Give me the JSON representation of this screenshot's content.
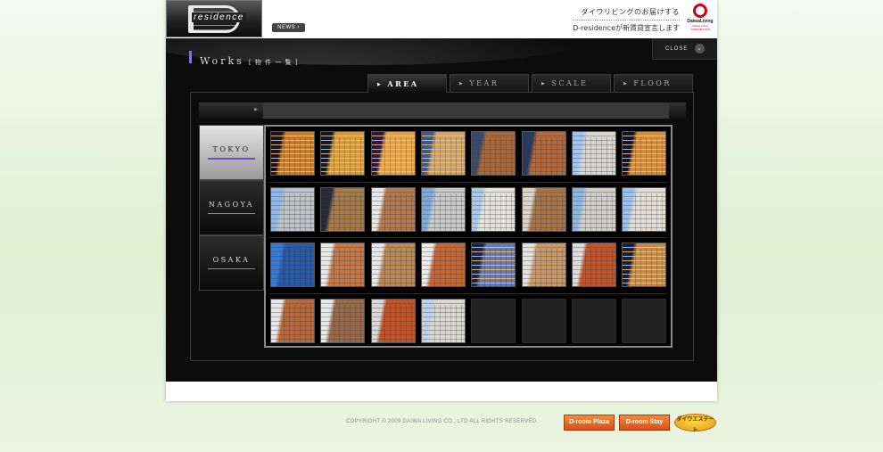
{
  "header": {
    "logo_text": "residence",
    "news_label": "NEWS ›",
    "tagline_line1": "ダイワリビングのお届けする",
    "tagline_line2": "D-residenceが新賃貸宣言します",
    "brand_name": "DaiwaLiving",
    "brand_sub": "Daiwa Living CORPORATION"
  },
  "main": {
    "close_label": "CLOSE",
    "close_icon": "chevron-down-icon",
    "title": "Works",
    "title_sub": "[ 物 件 一 覧 ]",
    "tabs": [
      {
        "label": "AREA",
        "active": true
      },
      {
        "label": "YEAR",
        "active": false
      },
      {
        "label": "SCALE",
        "active": false
      },
      {
        "label": "FLOOR",
        "active": false
      }
    ],
    "regions": [
      {
        "label": "TOKYO",
        "active": true
      },
      {
        "label": "NAGOYA",
        "active": false
      },
      {
        "label": "OSAKA",
        "active": false
      }
    ],
    "thumbnails": [
      {
        "tone": "night",
        "c1": "#1a1420",
        "c2": "#c97a2a"
      },
      {
        "tone": "night",
        "c1": "#10182e",
        "c2": "#d79a3a"
      },
      {
        "tone": "night",
        "c1": "#2a1848",
        "c2": "#e0a24a"
      },
      {
        "tone": "night",
        "c1": "#3a5a8a",
        "c2": "#c9a274"
      },
      {
        "tone": "dusk",
        "c1": "#3a4a6a",
        "c2": "#a86a3a"
      },
      {
        "tone": "dusk",
        "c1": "#2a3a5a",
        "c2": "#b5683a"
      },
      {
        "tone": "day",
        "c1": "#9fc4ee",
        "c2": "#d8d6d0"
      },
      {
        "tone": "night",
        "c1": "#0c1430",
        "c2": "#d5893a"
      },
      {
        "tone": "day",
        "c1": "#8fb8e8",
        "c2": "#bfc2c6"
      },
      {
        "tone": "dusk",
        "c1": "#262a34",
        "c2": "#a77a4a"
      },
      {
        "tone": "day",
        "c1": "#e8e6e2",
        "c2": "#b07a52"
      },
      {
        "tone": "day",
        "c1": "#7ea8dc",
        "c2": "#c8c8c8"
      },
      {
        "tone": "day",
        "c1": "#a8c8e8",
        "c2": "#e4e2dc"
      },
      {
        "tone": "day",
        "c1": "#d8d4cc",
        "c2": "#a8754a"
      },
      {
        "tone": "day",
        "c1": "#8eb4e2",
        "c2": "#d0cec8"
      },
      {
        "tone": "day",
        "c1": "#9cc0ea",
        "c2": "#e2ded4"
      },
      {
        "tone": "day",
        "c1": "#3a7ad0",
        "c2": "#2a5aa8"
      },
      {
        "tone": "day",
        "c1": "#e8e8e8",
        "c2": "#c47a48"
      },
      {
        "tone": "day",
        "c1": "#e6e6e6",
        "c2": "#b88a5a"
      },
      {
        "tone": "day",
        "c1": "#eaeaea",
        "c2": "#c06a3a"
      },
      {
        "tone": "night",
        "c1": "#16244a",
        "c2": "#6a7aa8"
      },
      {
        "tone": "day",
        "c1": "#e4e2dc",
        "c2": "#c69a6a"
      },
      {
        "tone": "day",
        "c1": "#dcdcdc",
        "c2": "#c2552a"
      },
      {
        "tone": "night",
        "c1": "#14203e",
        "c2": "#c48a4a"
      },
      {
        "tone": "day",
        "c1": "#e6e6e6",
        "c2": "#b8683a"
      },
      {
        "tone": "day",
        "c1": "#e8e8e8",
        "c2": "#9a6a4a"
      },
      {
        "tone": "day",
        "c1": "#d8d8d8",
        "c2": "#c0542a"
      },
      {
        "tone": "day",
        "c1": "#bcd0e8",
        "c2": "#d8d8d0"
      },
      {
        "tone": "empty"
      },
      {
        "tone": "empty"
      },
      {
        "tone": "empty"
      },
      {
        "tone": "empty"
      }
    ]
  },
  "footer": {
    "copyright": "COPYRIGHT © 2009 DAIWA LIVING CO., LTD ALL RIGHTS RESERVED.",
    "btn_plaza": "D-room Plaza",
    "btn_stay": "D-room Stay",
    "btn_estate": "ダイワエステート"
  },
  "colors": {
    "accent_purple": "#6b4bd1",
    "footer_orange": "#e8661f",
    "brand_red": "#d4001a"
  }
}
